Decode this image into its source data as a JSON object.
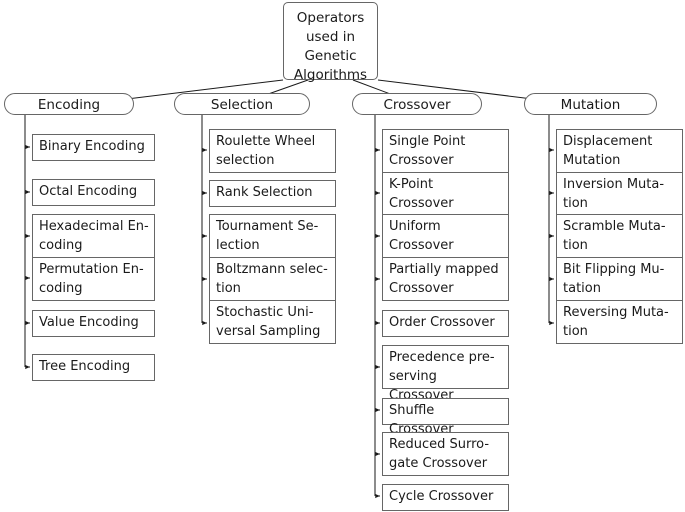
{
  "diagram": {
    "title": "Operators used in Genetic Algorithms",
    "root": {
      "label": "Operators\nused in\nGenetic\nAlgorithms"
    },
    "branches": [
      {
        "label": "Encoding",
        "items": [
          {
            "label": "Binary Encoding"
          },
          {
            "label": "Octal Encoding"
          },
          {
            "label": "Hexadecimal En-\ncoding"
          },
          {
            "label": "Permutation En-\ncoding"
          },
          {
            "label": "Value Encoding"
          },
          {
            "label": "Tree Encoding"
          }
        ]
      },
      {
        "label": "Selection",
        "items": [
          {
            "label": "Roulette Wheel\nselection"
          },
          {
            "label": "Rank Selection"
          },
          {
            "label": "Tournament Se-\nlection"
          },
          {
            "label": "Boltzmann selec-\ntion"
          },
          {
            "label": "Stochastic Uni-\nversal Sampling"
          }
        ]
      },
      {
        "label": "Crossover",
        "items": [
          {
            "label": "Single Point\nCrossover"
          },
          {
            "label": "K-Point\nCrossover"
          },
          {
            "label": "Uniform\nCrossover"
          },
          {
            "label": "Partially mapped\nCrossover"
          },
          {
            "label": "Order Crossover"
          },
          {
            "label": "Precedence pre-\nserving Crossover"
          },
          {
            "label": "Shuffle Crossover"
          },
          {
            "label": "Reduced Surro-\ngate Crossover"
          },
          {
            "label": "Cycle Crossover"
          }
        ]
      },
      {
        "label": "Mutation",
        "items": [
          {
            "label": "Displacement\nMutation"
          },
          {
            "label": "Inversion Muta-\ntion"
          },
          {
            "label": "Scramble Muta-\ntion"
          },
          {
            "label": "Bit Flipping Mu-\ntation"
          },
          {
            "label": "Reversing Muta-\ntion"
          }
        ]
      }
    ],
    "colors": {
      "stroke": "#666666",
      "edge": "#1a1a1a",
      "text": "#1a1a1a",
      "background": "#ffffff"
    }
  }
}
